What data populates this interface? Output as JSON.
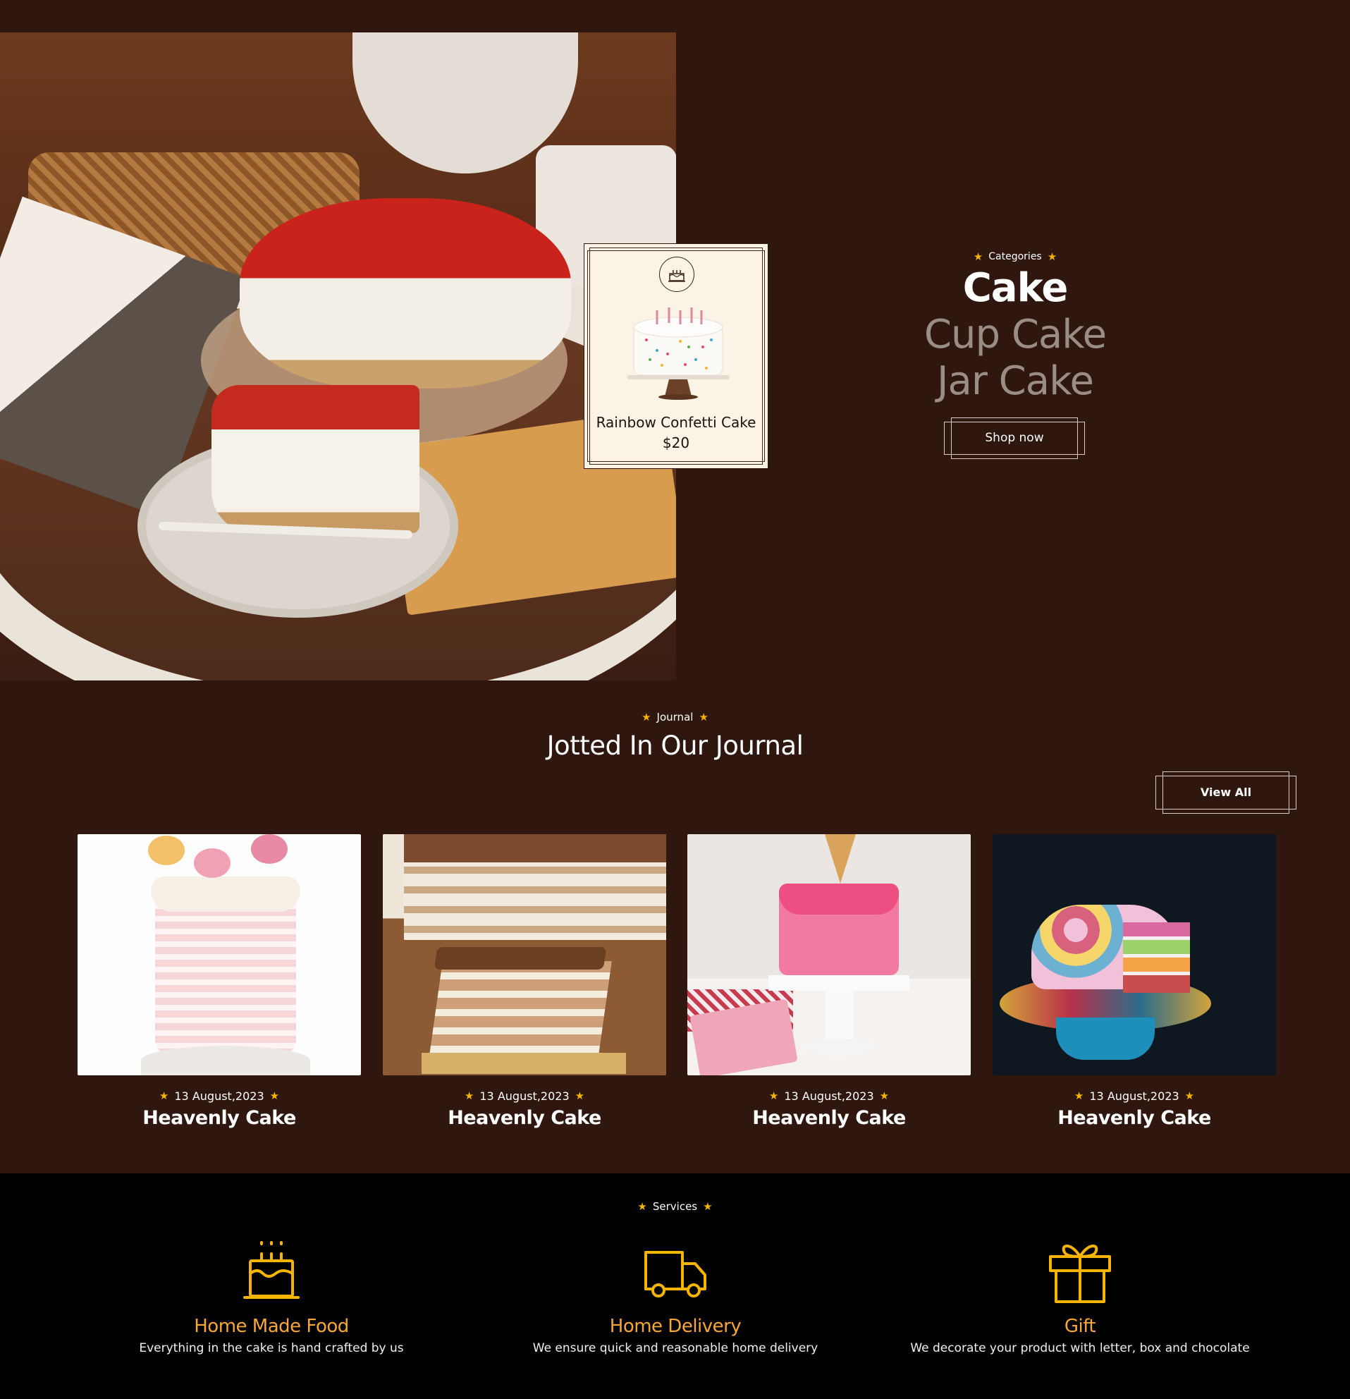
{
  "product_card": {
    "name": "Rainbow Confetti Cake",
    "price": "$20"
  },
  "categories": {
    "tag": "Categories",
    "items": [
      {
        "label": "Cake",
        "active": true
      },
      {
        "label": "Cup Cake",
        "active": false
      },
      {
        "label": "Jar Cake",
        "active": false
      }
    ],
    "shop_button": "Shop now"
  },
  "journal": {
    "tag": "Journal",
    "heading": "Jotted In Our Journal",
    "view_all": "View All",
    "posts": [
      {
        "date": "13 August,2023",
        "title": "Heavenly Cake"
      },
      {
        "date": "13 August,2023",
        "title": "Heavenly Cake"
      },
      {
        "date": "13 August,2023",
        "title": "Heavenly Cake"
      },
      {
        "date": "13 August,2023",
        "title": "Heavenly Cake"
      }
    ]
  },
  "services": {
    "tag": "Services",
    "items": [
      {
        "icon": "birthday-cake-icon",
        "title": "Home Made Food",
        "desc": "Everything in the cake is hand crafted by us"
      },
      {
        "icon": "delivery-truck-icon",
        "title": "Home Delivery",
        "desc": "We ensure quick and reasonable home delivery"
      },
      {
        "icon": "gift-box-icon",
        "title": "Gift",
        "desc": "We decorate your product with letter, box and chocolate"
      }
    ]
  },
  "colors": {
    "background": "#2f170f",
    "services_bg": "#000000",
    "accent_star": "#f5b400",
    "accent_orange": "#f7a737",
    "card_bg": "#fbf4e6"
  }
}
